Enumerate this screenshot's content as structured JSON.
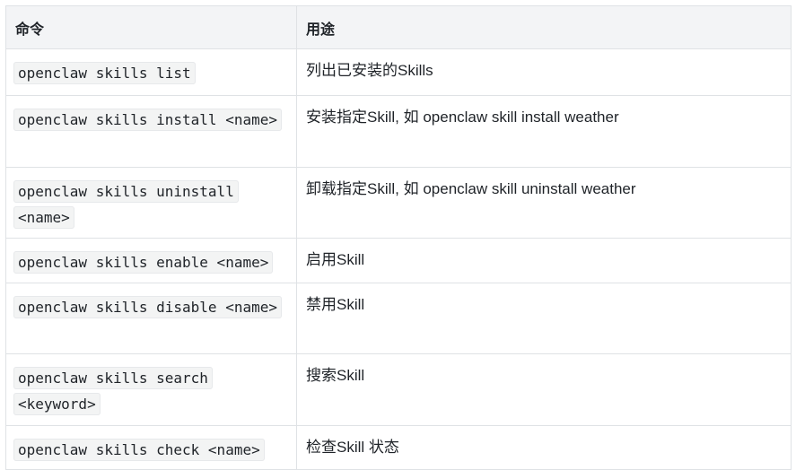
{
  "table": {
    "headers": [
      "命令",
      "用途"
    ],
    "rows": [
      {
        "command": "openclaw skills list",
        "purpose": "列出已安装的Skills"
      },
      {
        "command": "openclaw skills install <name>",
        "purpose": "安装指定Skill, 如 openclaw skill install weather"
      },
      {
        "command": "openclaw skills uninstall <name>",
        "purpose": "卸载指定Skill, 如 openclaw skill uninstall weather"
      },
      {
        "command": "openclaw skills enable <name>",
        "purpose": "启用Skill"
      },
      {
        "command": "openclaw skills disable <name>",
        "purpose": "禁用Skill"
      },
      {
        "command": "openclaw skills search <keyword>",
        "purpose": "搜索Skill"
      },
      {
        "command": "openclaw skills check <name>",
        "purpose": "检查Skill 状态"
      }
    ]
  }
}
